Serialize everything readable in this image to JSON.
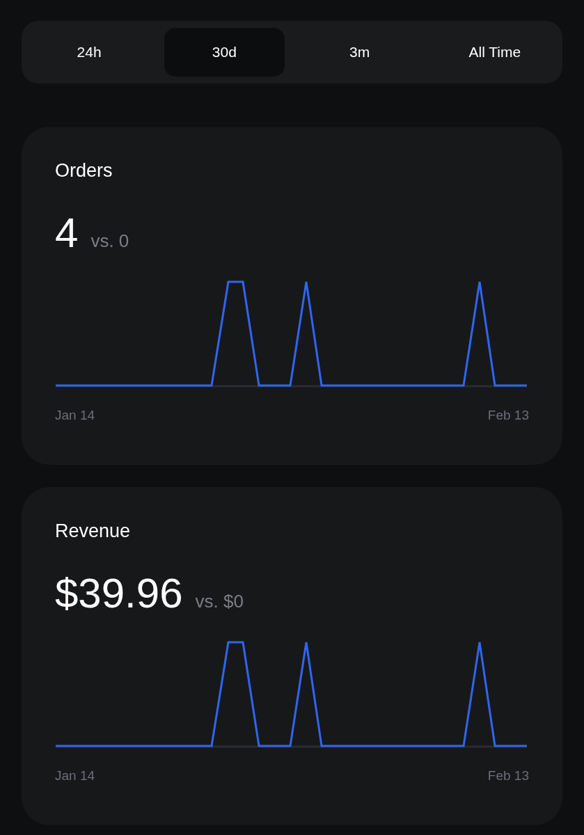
{
  "tabs": [
    {
      "label": "24h",
      "selected": false
    },
    {
      "label": "30d",
      "selected": true
    },
    {
      "label": "3m",
      "selected": false
    },
    {
      "label": "All Time",
      "selected": false
    }
  ],
  "cards": [
    {
      "title": "Orders",
      "value": "4",
      "comparison": "vs. 0",
      "x_start": "Jan 14",
      "x_end": "Feb 13"
    },
    {
      "title": "Revenue",
      "value": "$39.96",
      "comparison": "vs. $0",
      "x_start": "Jan 14",
      "x_end": "Feb 13"
    }
  ]
}
